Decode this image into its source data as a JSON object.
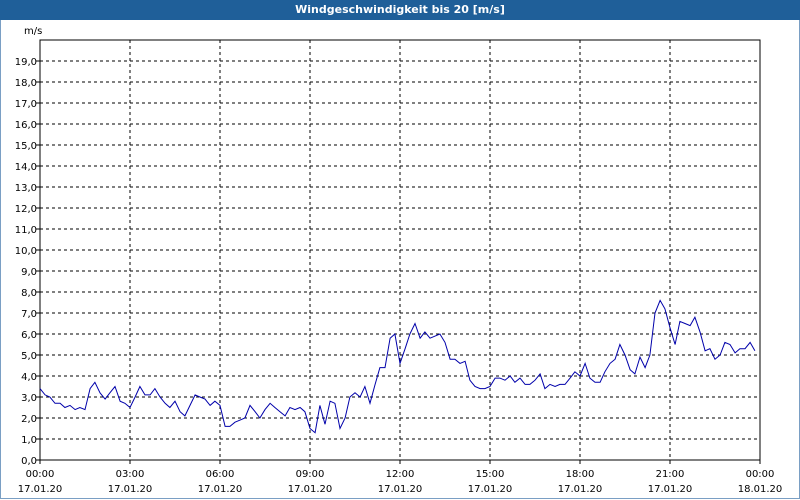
{
  "window": {
    "title": "Windgeschwindigkeit bis 20 [m/s]"
  },
  "chart_data": {
    "type": "line",
    "title": "Windgeschwindigkeit bis 20 [m/s]",
    "ylabel": "m/s",
    "xlabel": "",
    "ylim": [
      0,
      20
    ],
    "xlim_hours": [
      0,
      24
    ],
    "y_ticks": [
      "0,0",
      "1,0",
      "2,0",
      "3,0",
      "4,0",
      "5,0",
      "6,0",
      "7,0",
      "8,0",
      "9,0",
      "10,0",
      "11,0",
      "12,0",
      "13,0",
      "14,0",
      "15,0",
      "16,0",
      "17,0",
      "18,0",
      "19,0"
    ],
    "x_ticks": [
      {
        "time": "00:00",
        "date": "17.01.20"
      },
      {
        "time": "03:00",
        "date": "17.01.20"
      },
      {
        "time": "06:00",
        "date": "17.01.20"
      },
      {
        "time": "09:00",
        "date": "17.01.20"
      },
      {
        "time": "12:00",
        "date": "17.01.20"
      },
      {
        "time": "15:00",
        "date": "17.01.20"
      },
      {
        "time": "18:00",
        "date": "17.01.20"
      },
      {
        "time": "21:00",
        "date": "17.01.20"
      },
      {
        "time": "00:00",
        "date": "18.01.20"
      }
    ],
    "grid": true,
    "line_color": "#0000aa",
    "series": [
      {
        "x_hours": [
          0,
          0.17,
          0.33,
          0.5,
          0.67,
          0.83,
          1.0,
          1.17,
          1.33,
          1.5,
          1.67,
          1.83,
          2.0,
          2.17,
          2.33,
          2.5,
          2.67,
          2.83,
          3.0,
          3.17,
          3.33,
          3.5,
          3.67,
          3.83,
          4.0,
          4.17,
          4.33,
          4.5,
          4.67,
          4.83,
          5.0,
          5.17,
          5.33,
          5.5,
          5.67,
          5.83,
          6.0,
          6.17,
          6.33,
          6.5,
          6.67,
          6.83,
          7.0,
          7.17,
          7.33,
          7.5,
          7.67,
          7.83,
          8.0,
          8.17,
          8.33,
          8.5,
          8.67,
          8.83,
          9.0,
          9.17,
          9.33,
          9.5,
          9.67,
          9.83,
          10.0,
          10.17,
          10.33,
          10.5,
          10.67,
          10.83,
          11.0,
          11.17,
          11.33,
          11.5,
          11.67,
          11.83,
          12.0,
          12.17,
          12.33,
          12.5,
          12.67,
          12.83,
          13.0,
          13.17,
          13.33,
          13.5,
          13.67,
          13.83,
          14.0,
          14.17,
          14.33,
          14.5,
          14.67,
          14.83,
          15.0,
          15.17,
          15.33,
          15.5,
          15.67,
          15.83,
          16.0,
          16.17,
          16.33,
          16.5,
          16.67,
          16.83,
          17.0,
          17.17,
          17.33,
          17.5,
          17.67,
          17.83,
          18.0,
          18.17,
          18.33,
          18.5,
          18.67,
          18.83,
          19.0,
          19.17,
          19.33,
          19.5,
          19.67,
          19.83,
          20.0,
          20.17,
          20.33,
          20.5,
          20.67,
          20.83,
          21.0,
          21.17,
          21.33,
          21.5,
          21.67,
          21.83,
          22.0,
          22.17,
          22.33,
          22.5,
          22.67,
          22.83,
          23.0,
          23.17,
          23.33,
          23.5,
          23.67,
          23.83
        ],
        "values": [
          3.4,
          3.1,
          3.0,
          2.7,
          2.7,
          2.5,
          2.6,
          2.4,
          2.5,
          2.4,
          3.4,
          3.7,
          3.2,
          2.9,
          3.2,
          3.5,
          2.8,
          2.7,
          2.5,
          3.0,
          3.5,
          3.1,
          3.1,
          3.4,
          3.0,
          2.7,
          2.5,
          2.8,
          2.3,
          2.1,
          2.6,
          3.1,
          3.0,
          2.9,
          2.6,
          2.8,
          2.6,
          1.6,
          1.6,
          1.8,
          1.9,
          2.0,
          2.6,
          2.3,
          2.0,
          2.4,
          2.7,
          2.5,
          2.3,
          2.1,
          2.5,
          2.4,
          2.5,
          2.3,
          1.5,
          1.3,
          2.6,
          1.7,
          2.8,
          2.7,
          1.5,
          2.0,
          3.0,
          3.2,
          3.0,
          3.5,
          2.7,
          3.6,
          4.4,
          4.4,
          5.8,
          6.0,
          4.6,
          5.3,
          6.0,
          6.5,
          5.8,
          6.1,
          5.8,
          5.9,
          6.0,
          5.6,
          4.8,
          4.8,
          4.6,
          4.7,
          3.8,
          3.5,
          3.4,
          3.4,
          3.5,
          3.9,
          3.9,
          3.8,
          4.0,
          3.7,
          3.9,
          3.6,
          3.6,
          3.8,
          4.1,
          3.4,
          3.6,
          3.5,
          3.6,
          3.6,
          3.9,
          4.2,
          4.0,
          4.6,
          3.9,
          3.7,
          3.7,
          4.2,
          4.6,
          4.8,
          5.5,
          5.0,
          4.3,
          4.1,
          4.9,
          4.4,
          5.0,
          7.0,
          7.6,
          7.2,
          6.3,
          5.5,
          6.6,
          6.5,
          6.4,
          6.8,
          6.1,
          5.2,
          5.3,
          4.8,
          5.0,
          5.6,
          5.5,
          5.1,
          5.3,
          5.3,
          5.6,
          5.2,
          5.5,
          4.6,
          4.3,
          4.2
        ]
      }
    ]
  }
}
